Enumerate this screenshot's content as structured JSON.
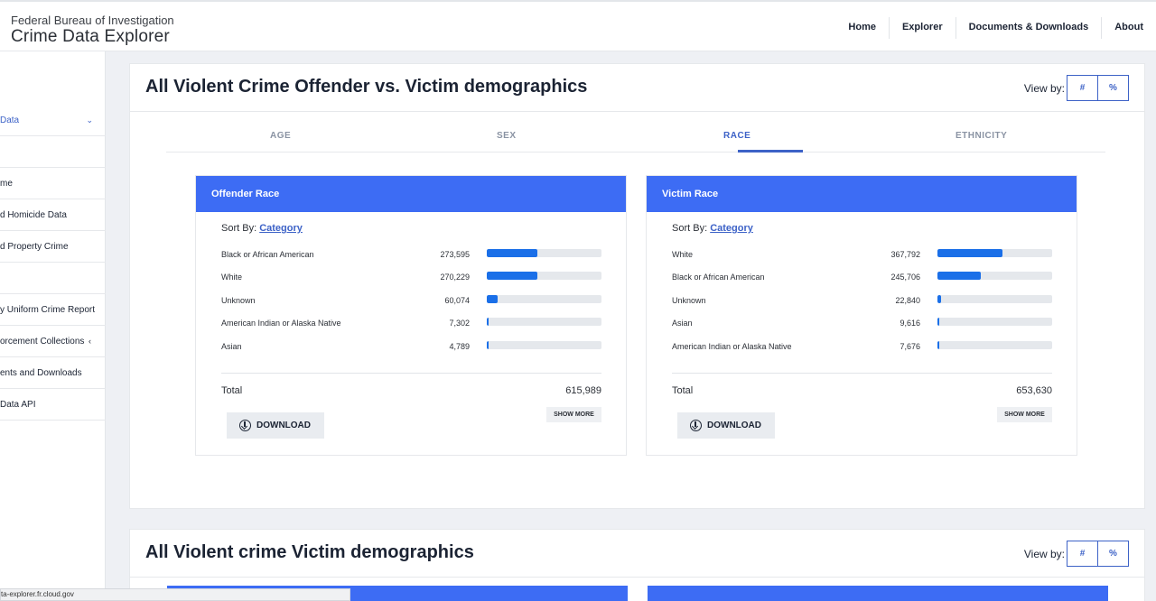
{
  "header": {
    "agency": "Federal Bureau of Investigation",
    "product": "Crime Data Explorer",
    "nav": [
      "Home",
      "Explorer",
      "Documents & Downloads",
      "About"
    ]
  },
  "sidebar": {
    "items": [
      {
        "label": "Data",
        "active": true,
        "chevron": "⌄"
      },
      {
        "label": ""
      },
      {
        "label": "me"
      },
      {
        "label": "d Homicide Data"
      },
      {
        "label": "d Property Crime"
      },
      {
        "label": ""
      },
      {
        "label": "y Uniform Crime Report"
      },
      {
        "label": "orcement Collections",
        "chevron": "‹"
      },
      {
        "label": "ents and Downloads"
      },
      {
        "label": "Data API"
      }
    ]
  },
  "card1": {
    "title": "All Violent Crime Offender vs. Victim demographics",
    "view_by_label": "View by:",
    "view_buttons": [
      "#",
      "%"
    ],
    "tabs": [
      "AGE",
      "SEX",
      "RACE",
      "ETHNICITY"
    ],
    "active_tab": "RACE",
    "panels": [
      {
        "title": "Offender Race",
        "sort_label": "Sort By:",
        "sort_value": "Category",
        "rows": [
          {
            "label": "Black or African American",
            "value": "273,595",
            "fraction": 0.444
          },
          {
            "label": "White",
            "value": "270,229",
            "fraction": 0.439
          },
          {
            "label": "Unknown",
            "value": "60,074",
            "fraction": 0.098
          },
          {
            "label": "American Indian or Alaska Native",
            "value": "7,302",
            "fraction": 0.012
          },
          {
            "label": "Asian",
            "value": "4,789",
            "fraction": 0.008
          }
        ],
        "total_label": "Total",
        "total_value": "615,989",
        "show_more": "SHOW MORE",
        "download": "DOWNLOAD"
      },
      {
        "title": "Victim Race",
        "sort_label": "Sort By:",
        "sort_value": "Category",
        "rows": [
          {
            "label": "White",
            "value": "367,792",
            "fraction": 0.563
          },
          {
            "label": "Black or African American",
            "value": "245,706",
            "fraction": 0.376
          },
          {
            "label": "Unknown",
            "value": "22,840",
            "fraction": 0.035
          },
          {
            "label": "Asian",
            "value": "9,616",
            "fraction": 0.015
          },
          {
            "label": "American Indian or Alaska Native",
            "value": "7,676",
            "fraction": 0.012
          }
        ],
        "total_label": "Total",
        "total_value": "653,630",
        "show_more": "SHOW MORE",
        "download": "DOWNLOAD"
      }
    ]
  },
  "card2": {
    "title": "All Violent crime Victim demographics",
    "view_by_label": "View by:",
    "view_buttons": [
      "#",
      "%"
    ]
  },
  "status": {
    "url": "ta-explorer.fr.cloud.gov"
  },
  "colors": {
    "accent": "#3d62c7",
    "panel_header": "#3d6cf4",
    "bar_fill": "#1a6fe8",
    "bar_track": "#e5e8ec"
  }
}
